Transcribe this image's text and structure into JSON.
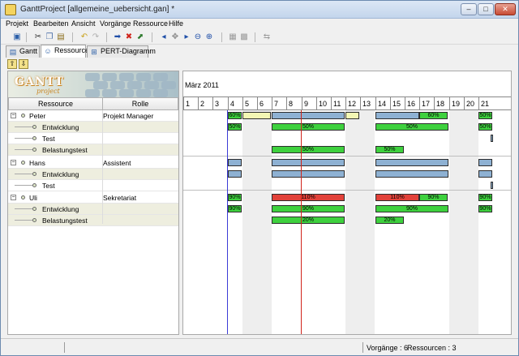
{
  "window": {
    "title": "GanttProject [allgemeine_uebersicht.gan] *",
    "minimize_label": "–",
    "maximize_label": "□",
    "close_label": "✕"
  },
  "menu": [
    "Projekt",
    "Bearbeiten",
    "Ansicht",
    "Vorgänge",
    "Ressource",
    "Hilfe"
  ],
  "toolbar_icons": [
    {
      "name": "save-icon",
      "glyph": "▣",
      "color": "#2b5fa8"
    },
    {
      "name": "cut-icon",
      "glyph": "✂",
      "color": "#333333"
    },
    {
      "name": "copy-icon",
      "glyph": "❐",
      "color": "#4a6fa8"
    },
    {
      "name": "paste-icon",
      "glyph": "▤",
      "color": "#8a6d1a"
    },
    {
      "name": "undo-icon",
      "glyph": "↶",
      "color": "#c9a21e"
    },
    {
      "name": "redo-icon",
      "glyph": "↷",
      "color": "#b0b0b0"
    },
    {
      "name": "indent-icon",
      "glyph": "➡",
      "color": "#1f4fa8"
    },
    {
      "name": "delete-icon",
      "glyph": "✖",
      "color": "#d0241c"
    },
    {
      "name": "properties-icon",
      "glyph": "⬈",
      "color": "#2d7a2d"
    },
    {
      "name": "scroll-left-icon",
      "glyph": "◂",
      "color": "#1f4fa8"
    },
    {
      "name": "scroll-center-icon",
      "glyph": "✥",
      "color": "#888888"
    },
    {
      "name": "scroll-right-icon",
      "glyph": "▸",
      "color": "#1f4fa8"
    },
    {
      "name": "zoom-out-icon",
      "glyph": "⊖",
      "color": "#1f4fa8"
    },
    {
      "name": "zoom-in-icon",
      "glyph": "⊕",
      "color": "#1f4fa8"
    },
    {
      "name": "link-icon",
      "glyph": "▦",
      "color": "#9a9a9a"
    },
    {
      "name": "unlink-icon",
      "glyph": "▩",
      "color": "#9a9a9a"
    },
    {
      "name": "critical-path-icon",
      "glyph": "⇆",
      "color": "#9a9a9a"
    }
  ],
  "tabs": [
    {
      "label": "Gantt",
      "icon": "gantt-icon",
      "glyph": "▤"
    },
    {
      "label": "Ressource",
      "icon": "resource-icon",
      "glyph": "☺"
    },
    {
      "label": "PERT-Diagramm",
      "icon": "pert-icon",
      "glyph": "⊞"
    }
  ],
  "sub_toolbar": [
    {
      "name": "move-up-icon",
      "glyph": "⇧"
    },
    {
      "name": "move-down-icon",
      "glyph": "⇩"
    }
  ],
  "logo": {
    "brand": "GANTT",
    "sub": "project"
  },
  "resource_table": {
    "headers": [
      "Ressource",
      "Rolle"
    ],
    "rows": [
      {
        "name": "Peter",
        "role": "Projekt Manager",
        "level": 0,
        "expander": "−"
      },
      {
        "name": "Entwicklung",
        "role": "",
        "level": 1
      },
      {
        "name": "Test",
        "role": "",
        "level": 1
      },
      {
        "name": "Belastungstest",
        "role": "",
        "level": 1
      },
      {
        "name": "Hans",
        "role": "Assistent",
        "level": 0,
        "expander": "−"
      },
      {
        "name": "Entwicklung",
        "role": "",
        "level": 1
      },
      {
        "name": "Test",
        "role": "",
        "level": 1
      },
      {
        "name": "Uli",
        "role": "Sekretariat",
        "level": 0,
        "expander": "−"
      },
      {
        "name": "Entwicklung",
        "role": "",
        "level": 1
      },
      {
        "name": "Belastungstest",
        "role": "",
        "level": 1
      }
    ]
  },
  "chart": {
    "month": "März 2011",
    "days": [
      "1",
      "2",
      "3",
      "4",
      "5",
      "6",
      "7",
      "8",
      "9",
      "10",
      "11",
      "12",
      "13",
      "14",
      "15",
      "16",
      "17",
      "18",
      "19",
      "20",
      "21"
    ],
    "weekend_days": [
      5,
      6,
      12,
      13,
      19,
      20
    ],
    "rows": [
      [
        {
          "s": 4,
          "e": 5,
          "c": "g",
          "t": "60%"
        },
        {
          "s": 5,
          "e": 7,
          "c": "y",
          "t": ""
        },
        {
          "s": 7,
          "e": 12,
          "c": "b",
          "t": ""
        },
        {
          "s": 12,
          "e": 13,
          "c": "y",
          "t": ""
        },
        {
          "s": 14,
          "e": 17,
          "c": "b",
          "t": ""
        },
        {
          "s": 17,
          "e": 19,
          "c": "g",
          "t": "60%"
        },
        {
          "s": 21,
          "e": 22,
          "c": "g",
          "t": "50%"
        }
      ],
      [
        {
          "s": 4,
          "e": 5,
          "c": "g",
          "t": "50%"
        },
        {
          "s": 7,
          "e": 12,
          "c": "g",
          "t": "50%"
        },
        {
          "s": 14,
          "e": 19,
          "c": "g",
          "t": "50%"
        },
        {
          "s": 21,
          "e": 22,
          "c": "g",
          "t": "50%"
        }
      ],
      [
        {
          "s": 21.8,
          "e": 22,
          "c": "b",
          "t": ""
        }
      ],
      [
        {
          "s": 7,
          "e": 12,
          "c": "g",
          "t": "50%"
        },
        {
          "s": 14,
          "e": 16,
          "c": "g",
          "t": "50%"
        }
      ],
      [
        {
          "s": 4,
          "e": 5,
          "c": "b",
          "t": ""
        },
        {
          "s": 7,
          "e": 12,
          "c": "b",
          "t": ""
        },
        {
          "s": 14,
          "e": 19,
          "c": "b",
          "t": ""
        },
        {
          "s": 21,
          "e": 22,
          "c": "b",
          "t": ""
        }
      ],
      [
        {
          "s": 4,
          "e": 5,
          "c": "b",
          "t": ""
        },
        {
          "s": 7,
          "e": 12,
          "c": "b",
          "t": ""
        },
        {
          "s": 14,
          "e": 19,
          "c": "b",
          "t": ""
        },
        {
          "s": 21,
          "e": 22,
          "c": "b",
          "t": ""
        }
      ],
      [
        {
          "s": 21.8,
          "e": 22,
          "c": "b",
          "t": ""
        }
      ],
      [
        {
          "s": 4,
          "e": 5,
          "c": "g",
          "t": "90%"
        },
        {
          "s": 7,
          "e": 12,
          "c": "r",
          "t": "110%"
        },
        {
          "s": 14,
          "e": 17,
          "c": "r",
          "t": "110%"
        },
        {
          "s": 17,
          "e": 19,
          "c": "g",
          "t": "90%"
        },
        {
          "s": 21,
          "e": 22,
          "c": "g",
          "t": "90%"
        }
      ],
      [
        {
          "s": 4,
          "e": 5,
          "c": "g",
          "t": "90%"
        },
        {
          "s": 7,
          "e": 12,
          "c": "g",
          "t": "90%"
        },
        {
          "s": 14,
          "e": 19,
          "c": "g",
          "t": "90%"
        },
        {
          "s": 21,
          "e": 22,
          "c": "g",
          "t": "90%"
        }
      ],
      [
        {
          "s": 7,
          "e": 12,
          "c": "g",
          "t": "20%"
        },
        {
          "s": 14,
          "e": 16,
          "c": "g",
          "t": "20%"
        }
      ]
    ],
    "today_line_day": 4,
    "today_line_color": "#3b3bd6",
    "marker_line_day": 9,
    "marker_line_color": "#d0241c"
  },
  "status": {
    "vorgaenge": "Vorgänge : 6",
    "ressourcen": "Ressourcen : 3"
  }
}
